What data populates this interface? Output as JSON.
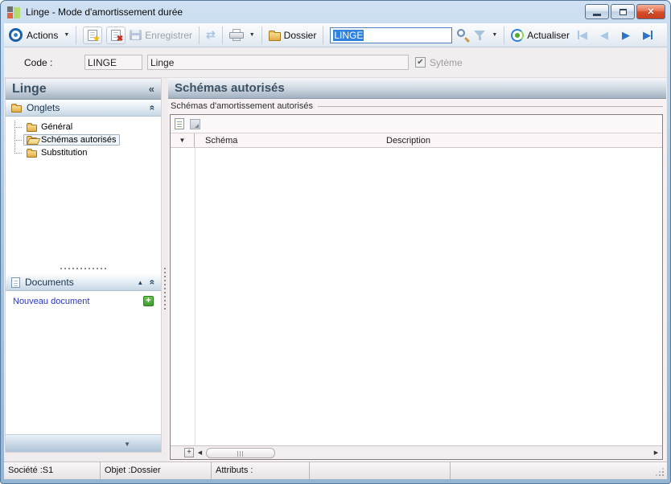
{
  "window": {
    "title": "Linge -  Mode d'amortissement durée"
  },
  "toolbar": {
    "actions_label": "Actions",
    "enregistrer_label": "Enregistrer",
    "dossier_label": "Dossier",
    "search_value": "LINGE",
    "actualiser_label": "Actualiser"
  },
  "form": {
    "code_label": "Code :",
    "code_value": "LINGE",
    "name_value": "Linge",
    "systeme_label": "Sytème",
    "systeme_checked": true
  },
  "sidebar": {
    "title": "Linge",
    "onglets": {
      "label": "Onglets",
      "items": [
        {
          "label": "Général",
          "selected": false
        },
        {
          "label": "Schémas autorisés",
          "selected": true
        },
        {
          "label": "Substitution",
          "selected": false
        }
      ]
    },
    "documents": {
      "label": "Documents",
      "new_doc_label": "Nouveau document"
    }
  },
  "main": {
    "title": "Schémas autorisés",
    "group_label": "Schémas d'amortissement autorisés",
    "table": {
      "columns": [
        "Schéma",
        "Description"
      ],
      "rows": []
    }
  },
  "statusbar": {
    "societe": "Société :S1",
    "objet": "Objet :Dossier",
    "attributs": "Attributs :"
  },
  "icons": {
    "collapse_left": "«",
    "collapse_up": "«",
    "documents_collapse": "▲",
    "dropdown": "▼",
    "check": "✔",
    "star": "★",
    "delete": "✖",
    "refresh": "⇄",
    "close": "✕",
    "plus": "+",
    "nav_prev": "◀",
    "nav_next": "▶",
    "panel_down": "▼",
    "row_marker": "▼",
    "scroll_left": "◀",
    "scroll_right": "▶",
    "scroll_plus": "+"
  },
  "colors": {
    "accent_blue": "#2f82de",
    "selection_blue": "#2f82de",
    "header_text": "#3c5064",
    "link_blue": "#2a35c8",
    "plus_green": "#3f9e2f",
    "close_red": "#c8401f",
    "disabled_text": "#9ba1a9",
    "folder_gold": "#e2ab45"
  }
}
